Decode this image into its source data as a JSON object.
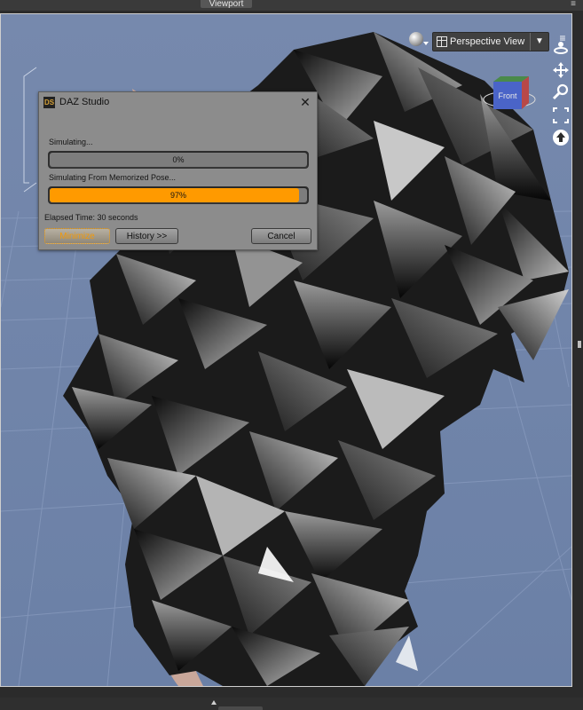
{
  "window": {
    "tab_label": "Viewport",
    "panel_menu_glyph": "≡"
  },
  "viewport": {
    "view_select": "Perspective View",
    "view_select_caret": "▼",
    "menu_glyph": "≡",
    "view_cube_label": "Front",
    "icons": {
      "render_preview": "sphere-icon",
      "layout": "layout-grid-icon",
      "orbit": "orbit-icon",
      "pan": "pan-icon",
      "zoom": "zoom-icon",
      "frame": "frame-icon",
      "reset": "reset-view-icon"
    }
  },
  "dialog": {
    "logo": "DS",
    "title": "DAZ Studio",
    "close_glyph": "✕",
    "status_1": "Simulating...",
    "progress_1": {
      "text": "0%",
      "fraction": 0.0
    },
    "status_2": "Simulating From Memorized Pose...",
    "progress_2": {
      "text": "97%",
      "fraction": 0.97
    },
    "elapsed": "Elapsed Time:  30 seconds",
    "buttons": {
      "minimize": "Minimize",
      "history": "History >>",
      "cancel": "Cancel"
    },
    "accent_color": "#ff9a00"
  }
}
